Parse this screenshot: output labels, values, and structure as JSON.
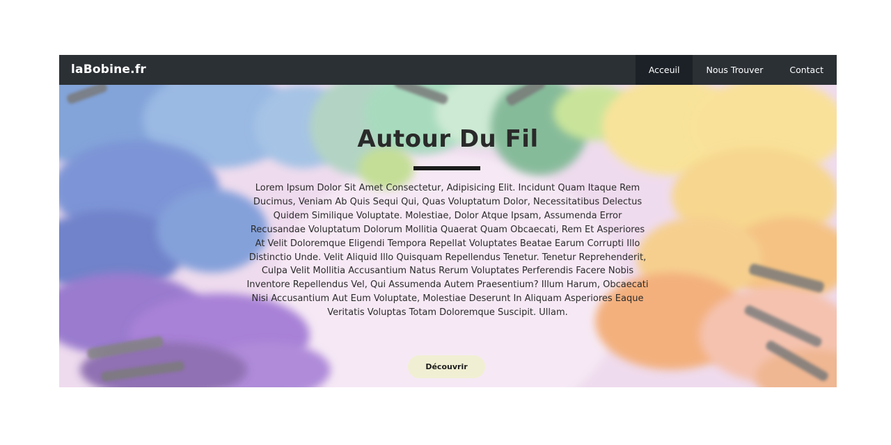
{
  "navbar": {
    "brand": "laBobine.fr",
    "items": [
      {
        "label": "Acceuil",
        "active": true
      },
      {
        "label": "Nous Trouver",
        "active": false
      },
      {
        "label": "Contact",
        "active": false
      }
    ],
    "background_color": "#2b3035",
    "active_color": "#1c2127"
  },
  "hero": {
    "title": "Autour Du Fil",
    "text": "Lorem Ipsum Dolor Sit Amet Consectetur, Adipisicing Elit. Incidunt Quam Itaque Rem Ducimus, Veniam Ab Quis Sequi Qui, Quas Voluptatum Dolor, Necessitatibus Delectus Quidem Similique Voluptate. Molestiae, Dolor Atque Ipsam, Assumenda Error Recusandae Voluptatum Dolorum Mollitia Quaerat Quam Obcaecati, Rem Et Asperiores At Velit Doloremque Eligendi Tempora Repellat Voluptates Beatae Earum Corrupti Illo Distinctio Unde. Velit Aliquid Illo Quisquam Repellendus Tenetur. Tenetur Reprehenderit, Culpa Velit Mollitia Accusantium Natus Rerum Voluptates Perferendis Facere Nobis Inventore Repellendus Vel, Qui Assumenda Autem Praesentium? Illum Harum, Obcaecati Nisi Accusantium Aut Eum Voluptate, Molestiae Deserunt In Aliquam Asperiores Eaque Veritatis Voluptas Totam Doloremque Suscipit. Ullam.",
    "button_label": "Découvrir",
    "button_color": "#f1efd3"
  }
}
